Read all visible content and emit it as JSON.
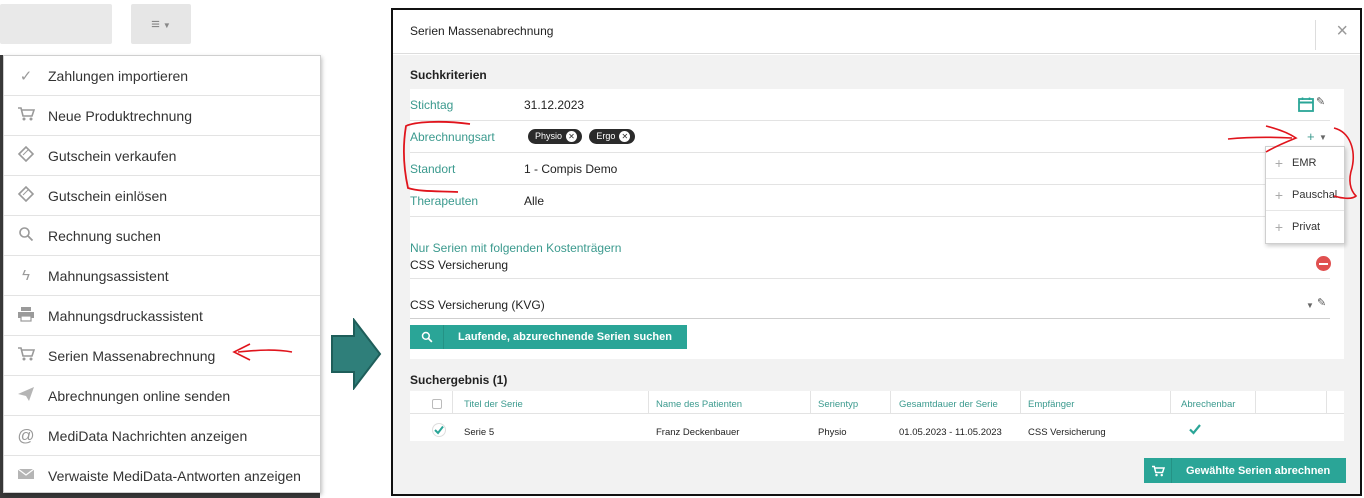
{
  "menu": {
    "items": [
      {
        "label": "Zahlungen importieren",
        "icon": "check-icon"
      },
      {
        "label": "Neue Produktrechnung",
        "icon": "cart-icon"
      },
      {
        "label": "Gutschein verkaufen",
        "icon": "ticket-icon"
      },
      {
        "label": "Gutschein einlösen",
        "icon": "ticket-icon"
      },
      {
        "label": "Rechnung suchen",
        "icon": "search-icon"
      },
      {
        "label": "Mahnungsassistent",
        "icon": "bolt-icon"
      },
      {
        "label": "Mahnungsdruckassistent",
        "icon": "printer-icon"
      },
      {
        "label": "Serien Massenabrechnung",
        "icon": "cart-icon"
      },
      {
        "label": "Abrechnungen online senden",
        "icon": "send-icon"
      },
      {
        "label": "MediData Nachrichten anzeigen",
        "icon": "at-icon"
      },
      {
        "label": "Verwaiste MediData-Antworten anzeigen",
        "icon": "mail-icon"
      }
    ]
  },
  "modal": {
    "title": "Serien Massenabrechnung",
    "close_label": "×",
    "criteria": {
      "section_title": "Suchkriterien",
      "stichtag_label": "Stichtag",
      "stichtag_value": "31.12.2023",
      "abrechnungsart_label": "Abrechnungsart",
      "tags": [
        "Physio",
        "Ergo"
      ],
      "standort_label": "Standort",
      "standort_value": "1 - Compis Demo",
      "therapeuten_label": "Therapeuten",
      "therapeuten_value": "Alle",
      "kostentraeger_label": "Nur Serien mit folgenden Kostenträgern",
      "kostentraeger_item": "CSS Versicherung",
      "kostentraeger_select": "CSS Versicherung (KVG)",
      "search_button": "Laufende, abzurechnende Serien suchen"
    },
    "results": {
      "section_title": "Suchergebnis (1)",
      "columns": [
        "Titel der Serie",
        "Name des Patienten",
        "Serientyp",
        "Gesamtdauer der Serie",
        "Empfänger",
        "Abrechenbar"
      ],
      "rows": [
        {
          "titel": "Serie 5",
          "patient": "Franz Deckenbauer",
          "serientyp": "Physio",
          "dauer": "01.05.2023 - 11.05.2023",
          "empfaenger": "CSS Versicherung",
          "abrechenbar": true,
          "selected": true
        }
      ]
    },
    "submit_button": "Gewählte Serien abrechnen"
  },
  "dropdown": {
    "items": [
      "EMR",
      "Pauschal",
      "Privat"
    ]
  },
  "colors": {
    "accent": "#2aa597",
    "label": "#3b9a8e",
    "annotation": "#e0141c"
  }
}
